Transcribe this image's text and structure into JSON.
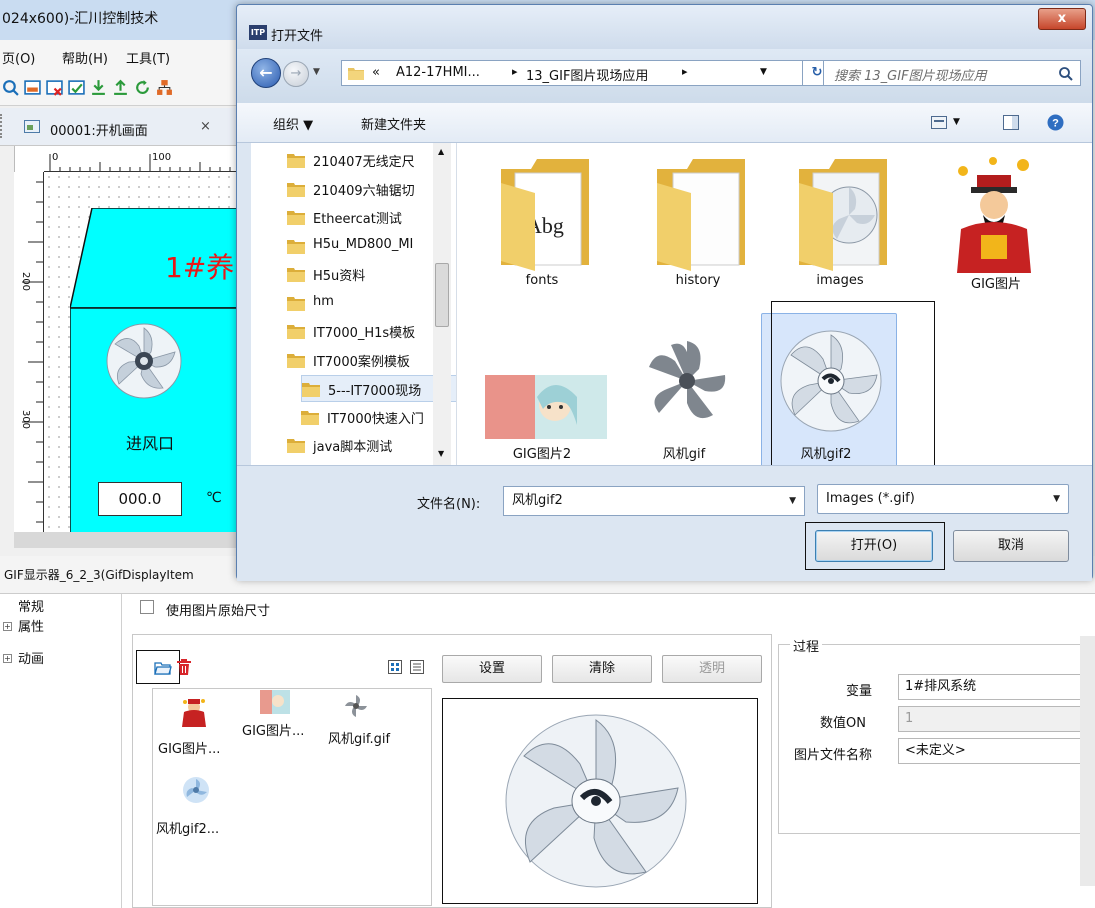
{
  "app": {
    "title": "024x600)-汇川控制技术",
    "menu": [
      "页(O)",
      "帮助(H)",
      "工具(T)"
    ],
    "tab_label": "00001:开机画面",
    "screen": {
      "banner": "1#养",
      "fan_label": "进风口",
      "temp_value": "000.0",
      "temp_unit": "℃",
      "ruler_h": "0",
      "ruler_h2": "100",
      "ruler_v": "200",
      "ruler_v2": "300"
    },
    "props_title": "GIF显示器_6_2_3(GifDisplayItem",
    "tree": [
      "常规",
      "属性",
      "动画"
    ],
    "checkbox_label": "使用图片原始尺寸",
    "btn_set": "设置",
    "btn_clear": "清除",
    "btn_transparent": "透明",
    "thumbs": [
      {
        "name": "GIG图片..."
      },
      {
        "name": "GIG图片..."
      },
      {
        "name": "风机gif.gif"
      },
      {
        "name": "风机gif2..."
      }
    ],
    "process": {
      "title": "过程",
      "var_label": "变量",
      "var_value": "1#排风系统",
      "on_label": "数值ON",
      "on_value": "1",
      "file_label": "图片文件名称",
      "file_value": "<未定义>"
    }
  },
  "dialog": {
    "title": "打开文件",
    "close": "x",
    "icon_text": "ITP",
    "breadcrumb": [
      "«",
      "A12-17HMI...",
      "▸",
      "13_GIF图片现场应用",
      "▸"
    ],
    "search_placeholder": "搜索 13_GIF图片现场应用",
    "toolbar": {
      "organize": "组织 ▼",
      "new_folder": "新建文件夹"
    },
    "nav_items": [
      "210407无线定尺",
      "210409六轴锯切",
      "Etheercat测试",
      "H5u_MD800_MI",
      "H5u资料",
      "hm",
      "IT7000_H1s模板",
      "IT7000案例模板",
      "5---IT7000现场",
      "IT7000快速入门",
      "java脚本测试"
    ],
    "files": [
      {
        "name": "fonts",
        "kind": "folder-fonts"
      },
      {
        "name": "history",
        "kind": "folder"
      },
      {
        "name": "images",
        "kind": "folder-images"
      },
      {
        "name": "GIG图片",
        "kind": "god-of-wealth"
      },
      {
        "name": "GIG图片2",
        "kind": "anime"
      },
      {
        "name": "风机gif",
        "kind": "fan-dark"
      },
      {
        "name": "风机gif2",
        "kind": "fan-light",
        "selected": true
      }
    ],
    "filename_label": "文件名(N):",
    "filename_value": "风机gif2",
    "filter_value": "Images (*.gif)",
    "open_button": "打开(O)",
    "cancel_button": "取消",
    "folder_thumb_text": "Abg"
  },
  "colors": {
    "screen_cyan": "#00ffff",
    "banner_red": "#e81818",
    "select_blue": "#d7e6fb"
  }
}
